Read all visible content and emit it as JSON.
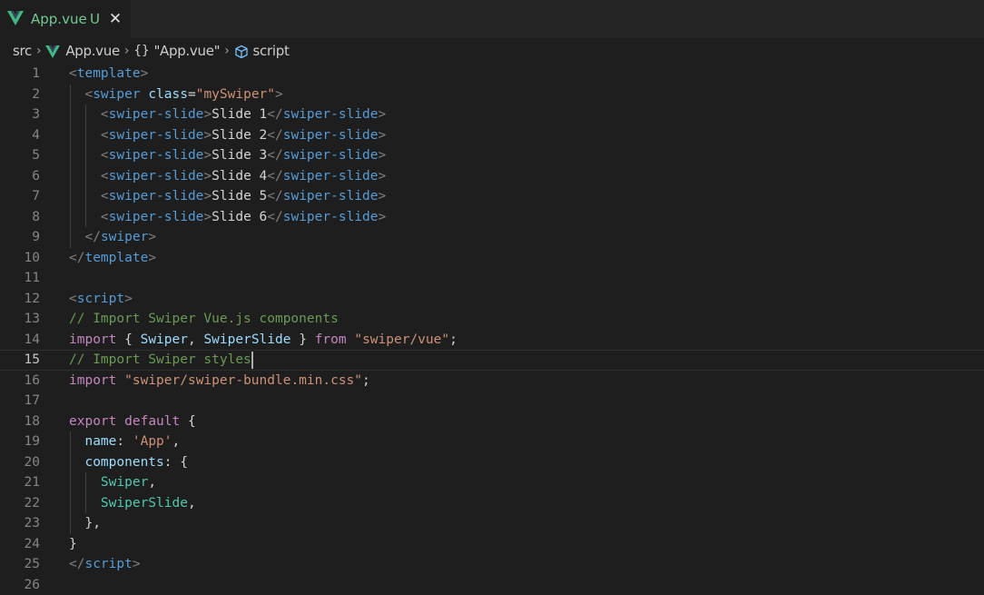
{
  "tab": {
    "icon": "vue-logo-icon",
    "title": "App.vue",
    "modified": "U",
    "close": "✕",
    "title_color": "#73c991"
  },
  "breadcrumb": {
    "items": [
      "src",
      "App.vue",
      "\"App.vue\"",
      "script"
    ],
    "braces": "{}",
    "separator": "›"
  },
  "editor": {
    "current_line": 15,
    "lines": [
      {
        "n": "1",
        "tokens": [
          {
            "t": "<",
            "c": "punc"
          },
          {
            "t": "template",
            "c": "tag"
          },
          {
            "t": ">",
            "c": "punc"
          }
        ]
      },
      {
        "n": "2",
        "tokens": [
          {
            "t": "  "
          },
          {
            "t": "<",
            "c": "punc"
          },
          {
            "t": "swiper",
            "c": "tag"
          },
          {
            "t": " "
          },
          {
            "t": "class",
            "c": "attr"
          },
          {
            "t": "=",
            "c": "text"
          },
          {
            "t": "\"mySwiper\"",
            "c": "str"
          },
          {
            "t": ">",
            "c": "punc"
          }
        ]
      },
      {
        "n": "3",
        "tokens": [
          {
            "t": "    "
          },
          {
            "t": "<",
            "c": "punc"
          },
          {
            "t": "swiper-slide",
            "c": "tag"
          },
          {
            "t": ">",
            "c": "punc"
          },
          {
            "t": "Slide 1",
            "c": "text"
          },
          {
            "t": "</",
            "c": "punc"
          },
          {
            "t": "swiper-slide",
            "c": "tag"
          },
          {
            "t": ">",
            "c": "punc"
          }
        ]
      },
      {
        "n": "4",
        "tokens": [
          {
            "t": "    "
          },
          {
            "t": "<",
            "c": "punc"
          },
          {
            "t": "swiper-slide",
            "c": "tag"
          },
          {
            "t": ">",
            "c": "punc"
          },
          {
            "t": "Slide 2",
            "c": "text"
          },
          {
            "t": "</",
            "c": "punc"
          },
          {
            "t": "swiper-slide",
            "c": "tag"
          },
          {
            "t": ">",
            "c": "punc"
          }
        ]
      },
      {
        "n": "5",
        "tokens": [
          {
            "t": "    "
          },
          {
            "t": "<",
            "c": "punc"
          },
          {
            "t": "swiper-slide",
            "c": "tag"
          },
          {
            "t": ">",
            "c": "punc"
          },
          {
            "t": "Slide 3",
            "c": "text"
          },
          {
            "t": "</",
            "c": "punc"
          },
          {
            "t": "swiper-slide",
            "c": "tag"
          },
          {
            "t": ">",
            "c": "punc"
          }
        ]
      },
      {
        "n": "6",
        "tokens": [
          {
            "t": "    "
          },
          {
            "t": "<",
            "c": "punc"
          },
          {
            "t": "swiper-slide",
            "c": "tag"
          },
          {
            "t": ">",
            "c": "punc"
          },
          {
            "t": "Slide 4",
            "c": "text"
          },
          {
            "t": "</",
            "c": "punc"
          },
          {
            "t": "swiper-slide",
            "c": "tag"
          },
          {
            "t": ">",
            "c": "punc"
          }
        ]
      },
      {
        "n": "7",
        "tokens": [
          {
            "t": "    "
          },
          {
            "t": "<",
            "c": "punc"
          },
          {
            "t": "swiper-slide",
            "c": "tag"
          },
          {
            "t": ">",
            "c": "punc"
          },
          {
            "t": "Slide 5",
            "c": "text"
          },
          {
            "t": "</",
            "c": "punc"
          },
          {
            "t": "swiper-slide",
            "c": "tag"
          },
          {
            "t": ">",
            "c": "punc"
          }
        ]
      },
      {
        "n": "8",
        "tokens": [
          {
            "t": "    "
          },
          {
            "t": "<",
            "c": "punc"
          },
          {
            "t": "swiper-slide",
            "c": "tag"
          },
          {
            "t": ">",
            "c": "punc"
          },
          {
            "t": "Slide 6",
            "c": "text"
          },
          {
            "t": "</",
            "c": "punc"
          },
          {
            "t": "swiper-slide",
            "c": "tag"
          },
          {
            "t": ">",
            "c": "punc"
          }
        ]
      },
      {
        "n": "9",
        "tokens": [
          {
            "t": "  "
          },
          {
            "t": "</",
            "c": "punc"
          },
          {
            "t": "swiper",
            "c": "tag"
          },
          {
            "t": ">",
            "c": "punc"
          }
        ]
      },
      {
        "n": "10",
        "tokens": [
          {
            "t": "</",
            "c": "punc"
          },
          {
            "t": "template",
            "c": "tag"
          },
          {
            "t": ">",
            "c": "punc"
          }
        ]
      },
      {
        "n": "11",
        "tokens": []
      },
      {
        "n": "12",
        "tokens": [
          {
            "t": "<",
            "c": "punc"
          },
          {
            "t": "script",
            "c": "tag"
          },
          {
            "t": ">",
            "c": "punc"
          }
        ]
      },
      {
        "n": "13",
        "tokens": [
          {
            "t": "// Import Swiper Vue.js components",
            "c": "comment"
          }
        ]
      },
      {
        "n": "14",
        "tokens": [
          {
            "t": "import",
            "c": "kw"
          },
          {
            "t": " { ",
            "c": "text"
          },
          {
            "t": "Swiper",
            "c": "var"
          },
          {
            "t": ", ",
            "c": "text"
          },
          {
            "t": "SwiperSlide",
            "c": "var"
          },
          {
            "t": " } ",
            "c": "text"
          },
          {
            "t": "from",
            "c": "kw"
          },
          {
            "t": " "
          },
          {
            "t": "\"swiper/vue\"",
            "c": "str"
          },
          {
            "t": ";",
            "c": "text"
          }
        ]
      },
      {
        "n": "15",
        "tokens": [
          {
            "t": "// Import Swiper styles",
            "c": "comment"
          }
        ]
      },
      {
        "n": "16",
        "tokens": [
          {
            "t": "import",
            "c": "kw"
          },
          {
            "t": " "
          },
          {
            "t": "\"swiper/swiper-bundle.min.css\"",
            "c": "str"
          },
          {
            "t": ";",
            "c": "text"
          }
        ]
      },
      {
        "n": "17",
        "tokens": []
      },
      {
        "n": "18",
        "tokens": [
          {
            "t": "export",
            "c": "kw"
          },
          {
            "t": " "
          },
          {
            "t": "default",
            "c": "kw"
          },
          {
            "t": " {",
            "c": "text"
          }
        ]
      },
      {
        "n": "19",
        "tokens": [
          {
            "t": "  "
          },
          {
            "t": "name",
            "c": "var"
          },
          {
            "t": ": ",
            "c": "text"
          },
          {
            "t": "'App'",
            "c": "str"
          },
          {
            "t": ",",
            "c": "text"
          }
        ]
      },
      {
        "n": "20",
        "tokens": [
          {
            "t": "  "
          },
          {
            "t": "components",
            "c": "var"
          },
          {
            "t": ": {",
            "c": "text"
          }
        ]
      },
      {
        "n": "21",
        "tokens": [
          {
            "t": "    "
          },
          {
            "t": "Swiper",
            "c": "comp"
          },
          {
            "t": ",",
            "c": "text"
          }
        ]
      },
      {
        "n": "22",
        "tokens": [
          {
            "t": "    "
          },
          {
            "t": "SwiperSlide",
            "c": "comp"
          },
          {
            "t": ",",
            "c": "text"
          }
        ]
      },
      {
        "n": "23",
        "tokens": [
          {
            "t": "  },",
            "c": "text"
          }
        ]
      },
      {
        "n": "24",
        "tokens": [
          {
            "t": "}",
            "c": "text"
          }
        ]
      },
      {
        "n": "25",
        "tokens": [
          {
            "t": "</",
            "c": "punc"
          },
          {
            "t": "script",
            "c": "tag"
          },
          {
            "t": ">",
            "c": "punc"
          }
        ]
      },
      {
        "n": "26",
        "tokens": []
      }
    ]
  }
}
